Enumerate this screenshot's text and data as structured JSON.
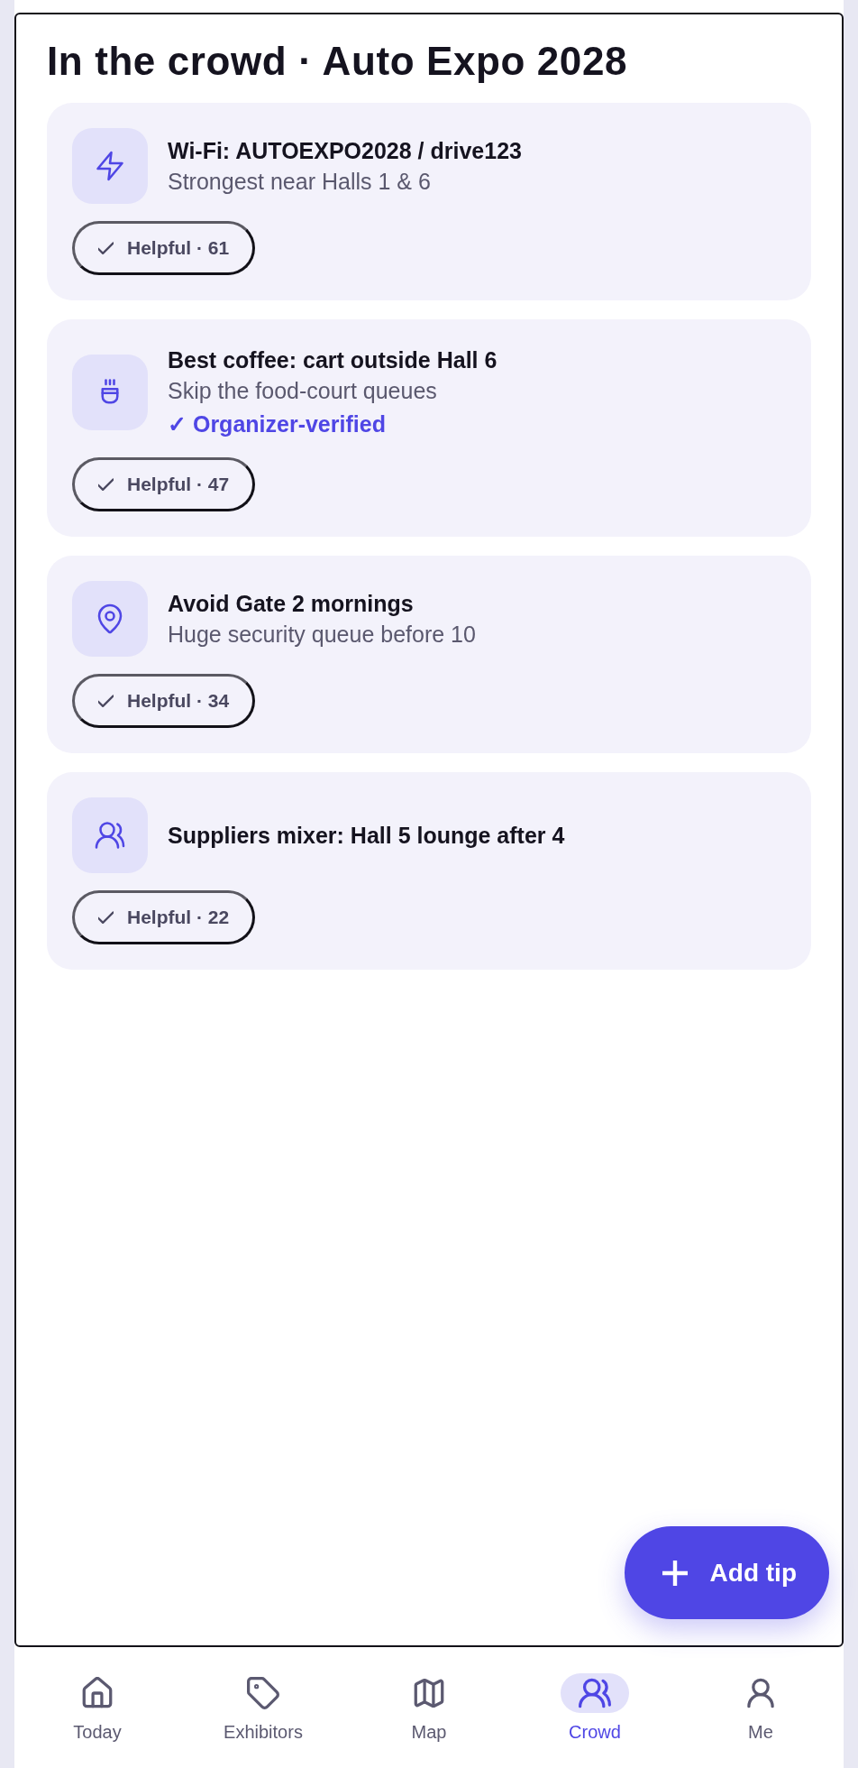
{
  "screen": {
    "title": "In the crowd · Auto Expo 2028"
  },
  "tips": [
    {
      "kind": "bolt",
      "title": "Wi-Fi: AUTOEXPO2028 / drive123",
      "subtitle": "Strongest near Halls 1 & 6",
      "helpful": "Helpful · 61"
    },
    {
      "kind": "cup",
      "title": "Best coffee: cart outside Hall 6",
      "subtitle": "Skip the food-court queues",
      "badge": "✓ Organizer-verified",
      "helpful": "Helpful · 47"
    },
    {
      "kind": "pin",
      "title": "Avoid Gate 2 mornings",
      "subtitle": "Huge security queue before 10",
      "helpful": "Helpful · 34"
    },
    {
      "kind": "people",
      "title": "Suppliers mixer: Hall 5 lounge after 4",
      "helpful": "Helpful · 22"
    }
  ],
  "fab": {
    "label": "Add tip"
  },
  "nav": [
    {
      "kind": "house",
      "label": "Today",
      "selected": false
    },
    {
      "kind": "tag",
      "label": "Exhibitors",
      "selected": false
    },
    {
      "kind": "map",
      "label": "Map",
      "selected": false
    },
    {
      "kind": "people",
      "label": "Crowd",
      "selected": true
    },
    {
      "kind": "person",
      "label": "Me",
      "selected": false
    }
  ]
}
